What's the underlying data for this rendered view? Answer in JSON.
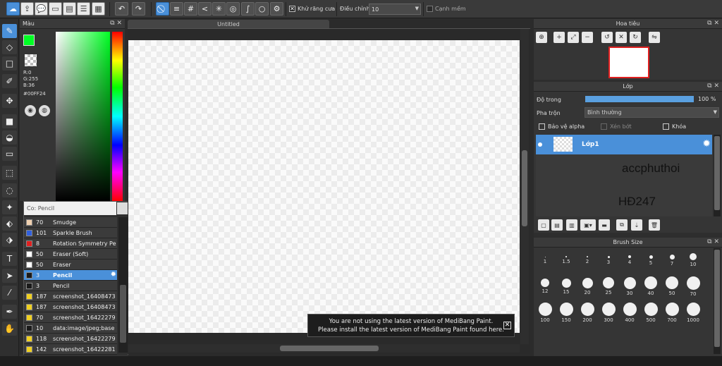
{
  "toolbar": {
    "antialias_label": "Khử răng cưa",
    "adjust_label": "Điều chỉnh",
    "adjust_value": "10",
    "edge_label": "Cạnh mềm"
  },
  "color_panel": {
    "title": "Màu",
    "r": "R:0",
    "g": "G:255",
    "b": "B:36",
    "hex": "#00FF24"
  },
  "brush_panel": {
    "search_placeholder": "Co: Pencil",
    "items": [
      {
        "size": "70",
        "name": "Smudge",
        "color": "#f0d0b0"
      },
      {
        "size": "101",
        "name": "Sparkle Brush",
        "color": "#3060e0"
      },
      {
        "size": "8",
        "name": "Rotation Symmetry Pe",
        "color": "#e02020"
      },
      {
        "size": "50",
        "name": "Eraser (Soft)",
        "color": "#ffffff"
      },
      {
        "size": "50",
        "name": "Eraser",
        "color": "#ffffff"
      },
      {
        "size": "3",
        "name": "Pencil",
        "color": "#1a1a1a"
      },
      {
        "size": "3",
        "name": "Pencil",
        "color": "#1a1a1a"
      },
      {
        "size": "187",
        "name": "screenshot_16408473",
        "color": "#f0d020"
      },
      {
        "size": "187",
        "name": "screenshot_16408473",
        "color": "#f0d020"
      },
      {
        "size": "70",
        "name": "screenshot_16422279",
        "color": "#f0d020"
      },
      {
        "size": "10",
        "name": "data:image/jpeg;base",
        "color": "#1a1a1a"
      },
      {
        "size": "118",
        "name": "screenshot_16422279",
        "color": "#f0d020"
      },
      {
        "size": "142",
        "name": "screenshot_16422281",
        "color": "#f0d020"
      }
    ]
  },
  "canvas": {
    "tab_title": "Untitled"
  },
  "notice": {
    "line1": "You are not using the latest version of MediBang Paint.",
    "line2": "Please install the latest version of MediBang Paint found here."
  },
  "navigator": {
    "title": "Hoa tiêu"
  },
  "layer_panel": {
    "title": "Lớp",
    "opacity_label": "Độ trong",
    "opacity_value": "100 %",
    "opacity_fraction": 1.0,
    "blend_label": "Pha trộn",
    "blend_value": "Bình thường",
    "protect_alpha": "Bảo vệ alpha",
    "clipping": "Xén bớt",
    "lock": "Khóa",
    "layer_name": "Lớp1",
    "watermark1": "accphuthoi",
    "watermark2": "HĐ247"
  },
  "brush_size_panel": {
    "title": "Brush Size",
    "sizes": [
      "1",
      "1.5",
      "2",
      "3",
      "4",
      "5",
      "7",
      "10",
      "12",
      "15",
      "20",
      "25",
      "30",
      "40",
      "50",
      "70",
      "100",
      "150",
      "200",
      "300",
      "400",
      "500",
      "700",
      "1000"
    ]
  }
}
